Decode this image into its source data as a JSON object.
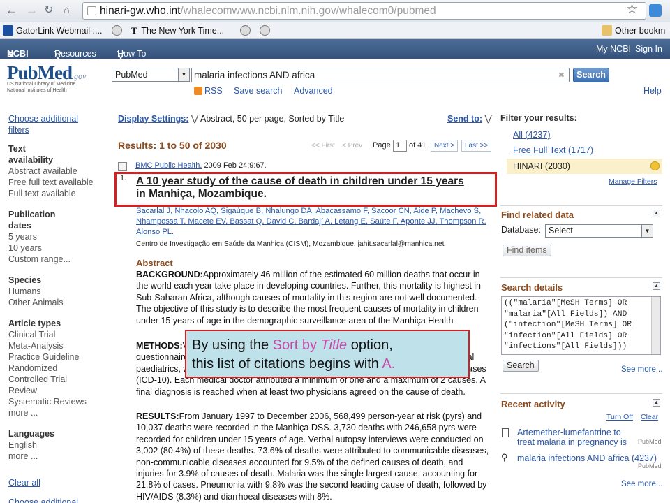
{
  "browser": {
    "url_domain": "hinari-gw.who.int",
    "url_path": "/whalecomwww.ncbi.nlm.nih.gov/whalecom0/pubmed",
    "bookmarks": [
      "GatorLink Webmail :...",
      "The New York Time...",
      "Other bookm"
    ]
  },
  "ncbi": {
    "logo": "NCBI",
    "resources": "Resources",
    "howto": "How To",
    "mync": "My NCBI",
    "signin": "Sign In"
  },
  "header": {
    "logo": "PubMed",
    "logo_gov": ".gov",
    "logo_sub": "US National Library of Medicine\nNational Institutes of Health",
    "db": "PubMed",
    "term": "malaria infections AND africa",
    "search": "Search",
    "rss": "RSS",
    "save": "Save search",
    "advanced": "Advanced",
    "help": "Help"
  },
  "left": {
    "choose": "Choose additional filters",
    "groups": [
      {
        "title": "Text availability",
        "items": [
          "Abstract available",
          "Free full text available",
          "Full text available"
        ]
      },
      {
        "title": "Publication dates",
        "items": [
          "5 years",
          "10 years",
          "Custom range..."
        ]
      },
      {
        "title": "Species",
        "items": [
          "Humans",
          "Other Animals"
        ]
      },
      {
        "title": "Article types",
        "items": [
          "Clinical Trial",
          "Meta-Analysis",
          "Practice Guideline",
          "Randomized Controlled Trial",
          "Review",
          "Systematic Reviews",
          "more ..."
        ]
      },
      {
        "title": "Languages",
        "items": [
          "English",
          "more ..."
        ]
      }
    ],
    "clear": "Clear all",
    "choose2": "Choose additional"
  },
  "center": {
    "display_label": "Display Settings:",
    "display_value": "Abstract, 50 per page, Sorted by Title",
    "sendto": "Send to:",
    "results": "Results: 1 to 50 of 2030",
    "first": "<< First",
    "prev": "< Prev",
    "page_label": "Page",
    "page": "1",
    "of": "of 41",
    "next": "Next >",
    "last": "Last >>",
    "num": "1.",
    "journal": "BMC Public Health.",
    "date": "2009 Feb 24;9:67.",
    "title1": "A 10 year study of the cause of death in children under 15 years",
    "title2": "in Manhiça, Mozambique.",
    "authors1": "Sacarlal J, Nhacolo AQ, Sigaúque B, Nhalungo DA, Abacassamo F, Sacoor CN, Aide P, Machevo S,",
    "authors2": "Nhampossa T, Macete EV, Bassat Q, David C, Bardají A, Letang E, Saúte F, Aponte JJ, Thompson R,",
    "authors3": "Alonso PL.",
    "affil": "Centro de Investigação em Saúde da Manhiça (CISM), Mozambique. jahit.sacarlal@manhica.net",
    "abstract_head": "Abstract",
    "bg_label": "BACKGROUND:",
    "bg_text": "Approximately 46 million of the estimated 60 million deaths that occur in the world each year take place in developing countries. Further, this mortality is highest in Sub-Saharan Africa, although causes of mortality in this region are not well documented. The objective of this study is to describe the most frequent causes of mortality in children under 15 years of age in the demographic surveillance area of the Manhiça Health Research Centre, between 1997 and 2006, using verbal autopsies.",
    "methods_label": "METHODS:",
    "methods_text": "Verbal autopsies were conducted in a random sample of deaths. Each questionnaire was reviewed by three independent physicians with experience in tropical paediatrics, who assigned a cause according to the International Classification of Diseases (ICD-10). Each medical doctor attributed a minimum of one and a maximum of 2 causes. A final diagnosis is reached when at least two physicians agreed on the cause of death.",
    "results_label": "RESULTS:",
    "results_text": "From January 1997 to December 2006, 568,499 person-year at risk (pyrs) and 10,037 deaths were recorded in the Manhiça DSS. 3,730 deaths with 246,658 pyrs were recorded for children under 15 years of age. Verbal autopsy interviews were conducted on 3,002 (80.4%) of these deaths. 73.6% of deaths were attributed to communicable diseases, non-communicable diseases accounted for 9.5% of the defined causes of death, and injuries for 3.9% of causes of death. Malaria was the single largest cause, accounting for 21.8% of cases. Pneumonia with 9.8% was the second leading cause of death, followed by HIV/AIDS (8.3%) and diarrhoeal diseases with 8%."
  },
  "callout": {
    "pre": "By using the ",
    "sort": "Sort by ",
    "title": "Title",
    "mid": " option,",
    "line2": "this list of citations begins with ",
    "a": "A."
  },
  "right": {
    "filter_head": "Filter your results:",
    "filters": [
      "All (4237)",
      "Free Full Text (1717)",
      "HINARI (2030)"
    ],
    "manage": "Manage Filters",
    "related_head": "Find related data",
    "database_label": "Database:",
    "database_value": "Select",
    "find_items": "Find items",
    "details_head": "Search details",
    "details_lines": [
      "((\"malaria\"[MeSH Terms] OR",
      "\"malaria\"[All Fields]) AND",
      "(\"infection\"[MeSH Terms] OR",
      "\"infection\"[All Fields] OR",
      "\"infections\"[All Fields]))"
    ],
    "search_btn": "Search",
    "see_more": "See more...",
    "recent_head": "Recent activity",
    "turn_off": "Turn Off",
    "clear": "Clear",
    "recent": [
      {
        "text": "Artemether-lumefantrine to treat malaria in pregnancy is assoc",
        "source": "PubMed"
      },
      {
        "text": "malaria infections AND africa (4237)",
        "source": "PubMed"
      }
    ],
    "see_more2": "See more..."
  }
}
